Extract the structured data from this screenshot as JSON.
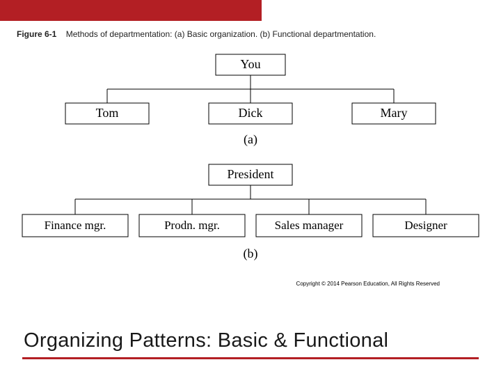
{
  "figure": {
    "label": "Figure 6-1",
    "caption": "Methods of departmentation: (a) Basic organization. (b) Functional departmentation."
  },
  "chart_data": [
    {
      "type": "tree",
      "id": "a",
      "label": "(a)",
      "root": "You",
      "children": [
        "Tom",
        "Dick",
        "Mary"
      ]
    },
    {
      "type": "tree",
      "id": "b",
      "label": "(b)",
      "root": "President",
      "children": [
        "Finance mgr.",
        "Prodn. mgr.",
        "Sales manager",
        "Designer"
      ]
    }
  ],
  "copyright": "Copyright © 2014 Pearson Education, All Rights Reserved",
  "slide_title": "Organizing Patterns:  Basic & Functional"
}
